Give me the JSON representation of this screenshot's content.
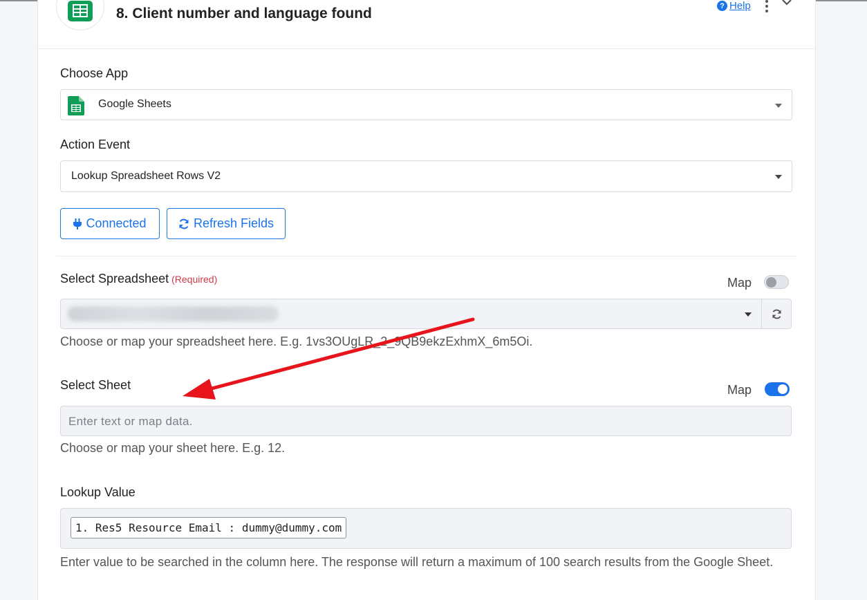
{
  "step": {
    "title": "8. Client number and language found",
    "help_label": "Help"
  },
  "choose_app": {
    "label": "Choose App",
    "value": "Google Sheets"
  },
  "action_event": {
    "label": "Action Event",
    "value": "Lookup Spreadsheet Rows V2"
  },
  "buttons": {
    "connected": "Connected",
    "refresh_fields": "Refresh Fields"
  },
  "select_spreadsheet": {
    "label": "Select Spreadsheet",
    "required": "(Required)",
    "map_label": "Map",
    "map_enabled": false,
    "hint": "Choose or map your spreadsheet here. E.g. 1vs3OUgLR_2_9QB9ekzExhmX_6m5Oi."
  },
  "select_sheet": {
    "label": "Select Sheet",
    "map_label": "Map",
    "map_enabled": true,
    "placeholder": "Enter text or map data.",
    "hint": "Choose or map your sheet here. E.g. 12."
  },
  "lookup_value": {
    "label": "Lookup Value",
    "chip": "1. Res5 Resource Email : dummy@dummy.com",
    "hint": "Enter value to be searched in the column here. The response will return a maximum of 100 search results from the Google Sheet."
  },
  "colors": {
    "accent": "#1a73e8",
    "sheets_green": "#0f9d58",
    "required_red": "#d0384a",
    "annotation_arrow": "#e8141c"
  }
}
